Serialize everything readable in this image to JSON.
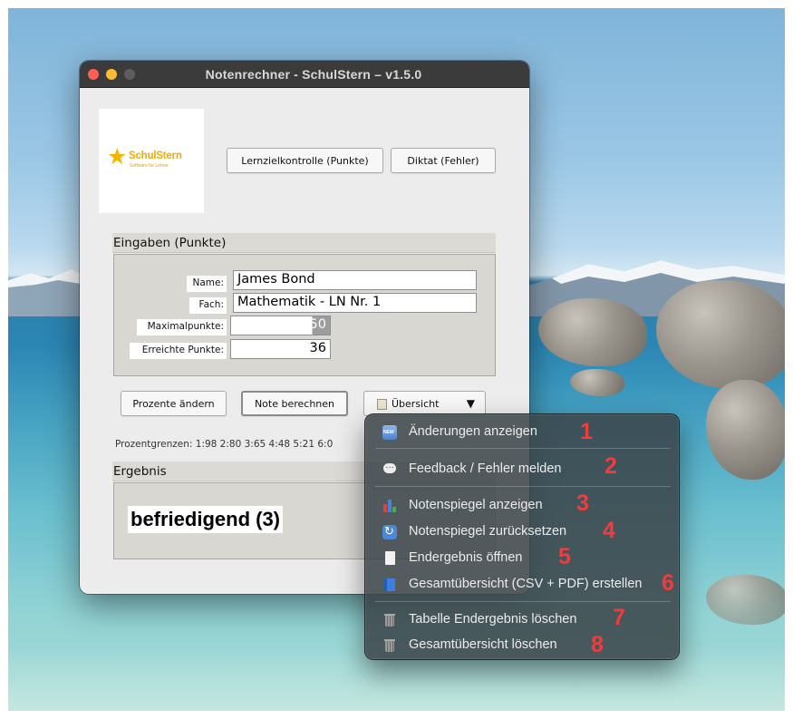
{
  "window": {
    "title": "Notenrechner - SchulStern  –  v1.5.0"
  },
  "logo": {
    "brand": "SchulStern",
    "tagline": "Software für Lehrer"
  },
  "mode_buttons": {
    "points": "Lernzielkontrolle (Punkte)",
    "errors": "Diktat (Fehler)"
  },
  "inputs": {
    "section_title": "Eingaben (Punkte)",
    "name_label": "Name:",
    "name_value": "James Bond",
    "subject_label": "Fach:",
    "subject_value": "Mathematik - LN Nr. 1",
    "max_label": "Maximalpunkte:",
    "max_value": "50",
    "achieved_label": "Erreichte Punkte:",
    "achieved_value": "36"
  },
  "actions": {
    "percent_button": "Prozente ändern",
    "calculate_button": "Note berechnen",
    "overview_dropdown": "Übersicht"
  },
  "percent_limits": "Prozentgrenzen: 1:98  2:80  3:65  4:48  5:21  6:0",
  "result": {
    "section_title": "Ergebnis",
    "grade": "befriedigend (3)"
  },
  "menu": {
    "items": [
      {
        "label": "Änderungen anzeigen",
        "icon": "new-badge-icon",
        "badge": "1"
      },
      {
        "label": "Feedback / Fehler melden",
        "icon": "chat-bubble-icon",
        "badge": "2"
      },
      {
        "label": "Notenspiegel anzeigen",
        "icon": "bar-chart-icon",
        "badge": "3"
      },
      {
        "label": "Notenspiegel zurücksetzen",
        "icon": "reset-cycle-icon",
        "badge": "4"
      },
      {
        "label": "Endergebnis öffnen",
        "icon": "document-icon",
        "badge": "5"
      },
      {
        "label": "Gesamtübersicht (CSV + PDF) erstellen",
        "icon": "book-icon",
        "badge": "6"
      },
      {
        "label": "Tabelle Endergebnis löschen",
        "icon": "trash-icon",
        "badge": "7"
      },
      {
        "label": "Gesamtübersicht löschen",
        "icon": "trash-icon",
        "badge": "8"
      }
    ]
  },
  "colors": {
    "badge_red": "#f03c3c",
    "brand_orange": "#f5a800",
    "close_red": "#ff5f57",
    "minimize_yellow": "#febc2e"
  }
}
